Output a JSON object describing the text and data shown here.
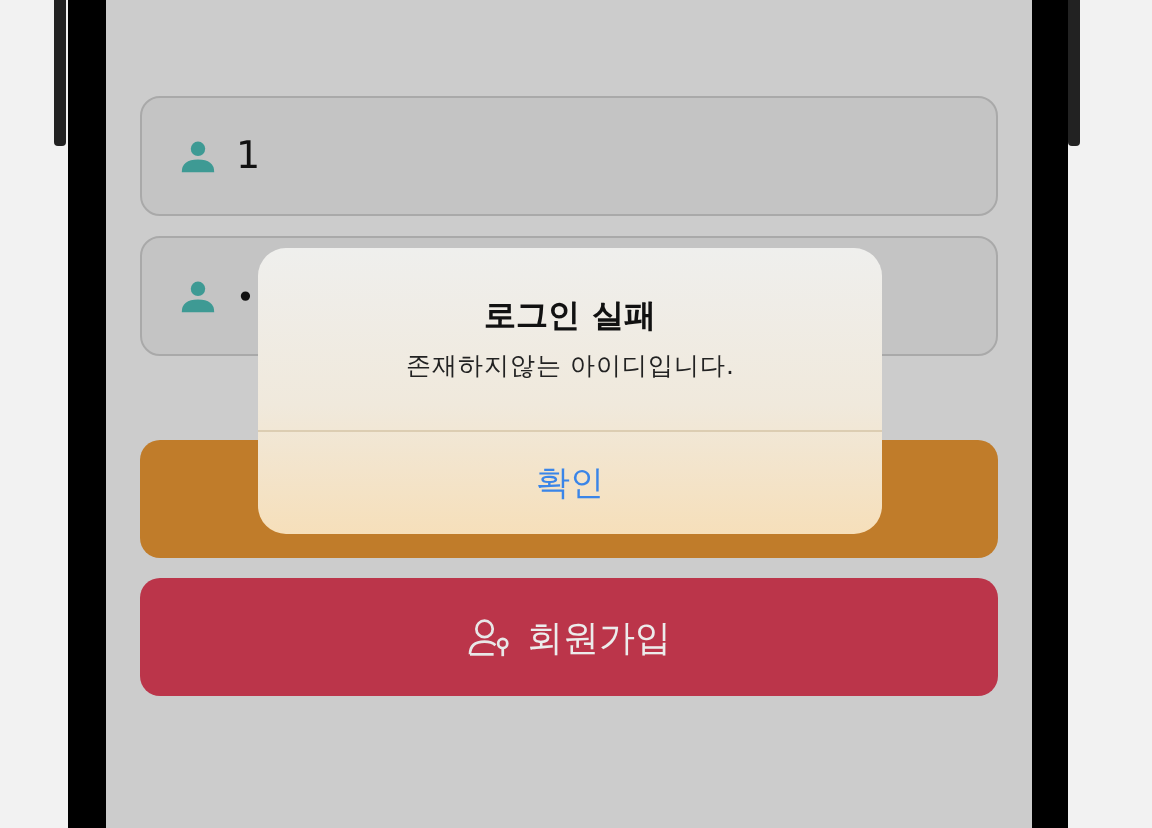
{
  "login_form": {
    "fields": [
      {
        "kind": "text",
        "value": "1"
      },
      {
        "kind": "password",
        "value": "•"
      }
    ],
    "buttons": [
      {
        "kind": "login"
      },
      {
        "kind": "signup",
        "label": "회원가입"
      }
    ]
  },
  "alert": {
    "title": "로그인 실패",
    "message": "존재하지않는 아이디입니다.",
    "buttons": [
      "확인"
    ]
  }
}
